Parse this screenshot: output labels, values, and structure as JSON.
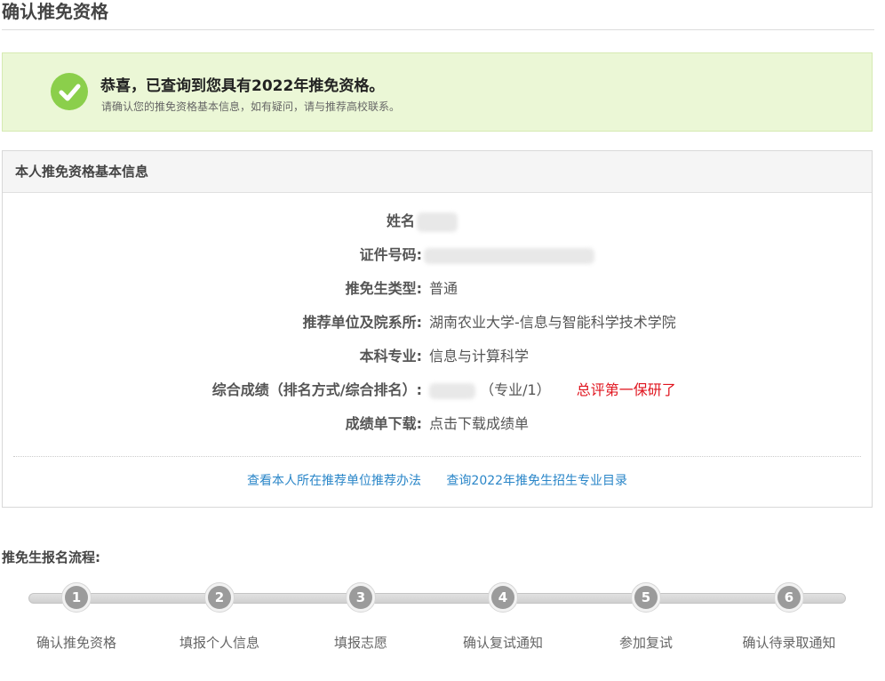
{
  "page": {
    "title": "确认推免资格"
  },
  "success": {
    "title": "恭喜，已查询到您具有2022年推免资格。",
    "subtitle": "请确认您的推免资格基本信息，如有疑问，请与推荐高校联系。",
    "icon": "check-circle-icon",
    "accent": "#8bcf4b"
  },
  "info": {
    "header": "本人推免资格基本信息",
    "rows": [
      {
        "label": "姓名",
        "value": ""
      },
      {
        "label": "证件号码:",
        "value": ""
      },
      {
        "label": "推免生类型:",
        "value": "普通"
      },
      {
        "label": "推荐单位及院系所:",
        "value": "湖南农业大学-信息与智能科学技术学院"
      },
      {
        "label": "本科专业:",
        "value": "信息与计算科学"
      },
      {
        "label": "综合成绩（排名方式/综合排名）:",
        "value": "（专业/1）",
        "note": "总评第一保研了"
      },
      {
        "label": "成绩单下载:",
        "value": "点击下载成绩单"
      }
    ],
    "links": [
      "查看本人所在推荐单位推荐办法",
      "查询2022年推免生招生专业目录"
    ],
    "link_color": "#2a86c8",
    "note_color": "#e0141e"
  },
  "flow": {
    "title": "推免生报名流程:",
    "steps": [
      {
        "num": "1",
        "label": "确认推免资格"
      },
      {
        "num": "2",
        "label": "填报个人信息"
      },
      {
        "num": "3",
        "label": "填报志愿"
      },
      {
        "num": "4",
        "label": "确认复试通知"
      },
      {
        "num": "5",
        "label": "参加复试"
      },
      {
        "num": "6",
        "label": "确认待录取通知"
      }
    ]
  }
}
